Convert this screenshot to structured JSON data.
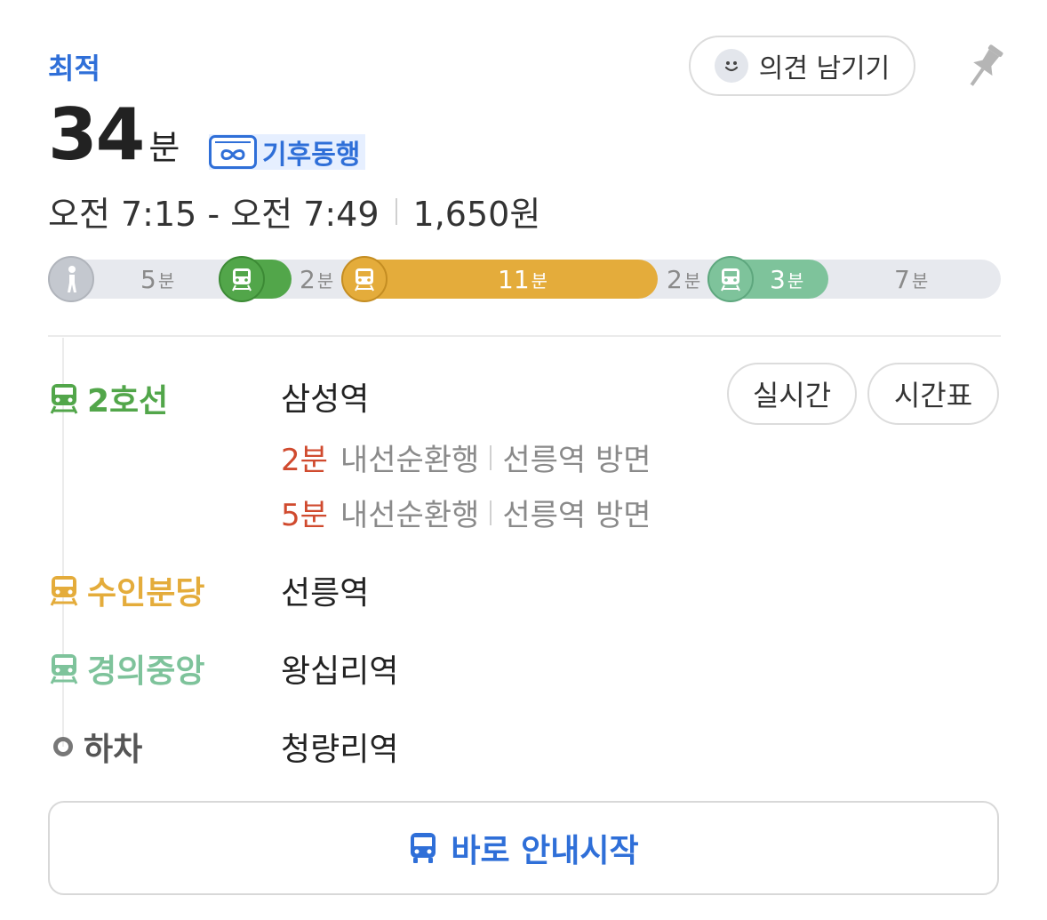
{
  "header": {
    "best_label": "최적",
    "feedback_label": "의견 남기기"
  },
  "summary": {
    "duration_number": "34",
    "duration_unit": "분",
    "climate_label": "기후동행",
    "time_range": "오전 7:15 - 오전 7:49",
    "fare": "1,650원"
  },
  "segments": [
    {
      "mode": "walk",
      "minutes": "5",
      "unit": "분",
      "color": "#e7e9ee"
    },
    {
      "mode": "subway",
      "line": "2호선",
      "minutes": "2",
      "unit": "분",
      "color": "#52a64a"
    },
    {
      "mode": "subway",
      "line": "수인분당",
      "minutes": "11",
      "unit": "분",
      "color": "#e4ac3b"
    },
    {
      "mode": "transfer-walk",
      "minutes": "2",
      "unit": "분",
      "color": "#e7e9ee"
    },
    {
      "mode": "subway",
      "line": "경의중앙",
      "minutes": "3",
      "unit": "분",
      "color": "#7ec39b"
    },
    {
      "mode": "walk",
      "minutes": "7",
      "unit": "분",
      "color": "#e7e9ee"
    }
  ],
  "steps": [
    {
      "line": "2호선",
      "color": "#52a64a",
      "station": "삼성역",
      "arrivals": [
        {
          "min": "2분",
          "direction": "내선순환행",
          "toward": "선릉역 방면"
        },
        {
          "min": "5분",
          "direction": "내선순환행",
          "toward": "선릉역 방면"
        }
      ],
      "realtime_label": "실시간",
      "timetable_label": "시간표"
    },
    {
      "line": "수인분당",
      "color": "#e4ac3b",
      "station": "선릉역"
    },
    {
      "line": "경의중앙",
      "color": "#7ec39b",
      "station": "왕십리역"
    },
    {
      "line": "하차",
      "color": "#555555",
      "station": "청량리역"
    }
  ],
  "start_button": {
    "label": "바로 안내시작",
    "icon": "bus-icon"
  }
}
